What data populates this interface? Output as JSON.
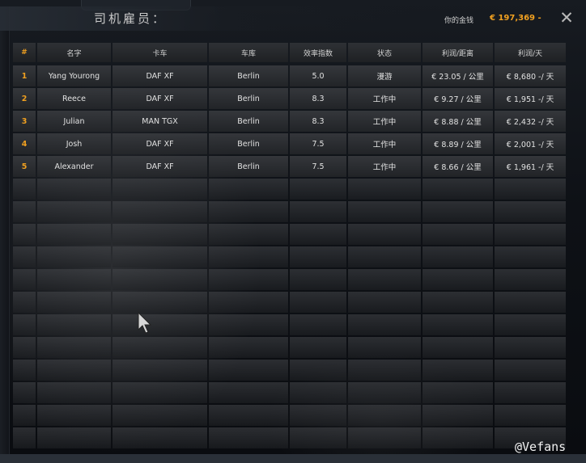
{
  "window": {
    "title": "司机雇员：",
    "money_label": "你的金钱",
    "money_value": "€ 197,369 -",
    "close_icon": "close-icon"
  },
  "table": {
    "headers": [
      "#",
      "名字",
      "卡车",
      "车库",
      "效率指数",
      "状态",
      "利润/距离",
      "利润/天"
    ],
    "rows": [
      [
        "1",
        "Yang Yourong",
        "DAF XF",
        "Berlin",
        "5.0",
        "漫游",
        "€ 23.05 / 公里",
        "€ 8,680 -/ 天"
      ],
      [
        "2",
        "Reece",
        "DAF XF",
        "Berlin",
        "8.3",
        "工作中",
        "€ 9.27 / 公里",
        "€ 1,951 -/ 天"
      ],
      [
        "3",
        "Julian",
        "MAN TGX",
        "Berlin",
        "8.3",
        "工作中",
        "€ 8.88 / 公里",
        "€ 2,432 -/ 天"
      ],
      [
        "4",
        "Josh",
        "DAF XF",
        "Berlin",
        "7.5",
        "工作中",
        "€ 8.89 / 公里",
        "€ 2,001 -/ 天"
      ],
      [
        "5",
        "Alexander",
        "DAF XF",
        "Berlin",
        "7.5",
        "工作中",
        "€ 8.66 / 公里",
        "€ 1,961 -/ 天"
      ]
    ],
    "empty_rows": 12
  },
  "watermark": "@Vefans",
  "colors": {
    "accent": "#f0a020",
    "text": "#e2e2e2",
    "background": "#0b0e12"
  }
}
